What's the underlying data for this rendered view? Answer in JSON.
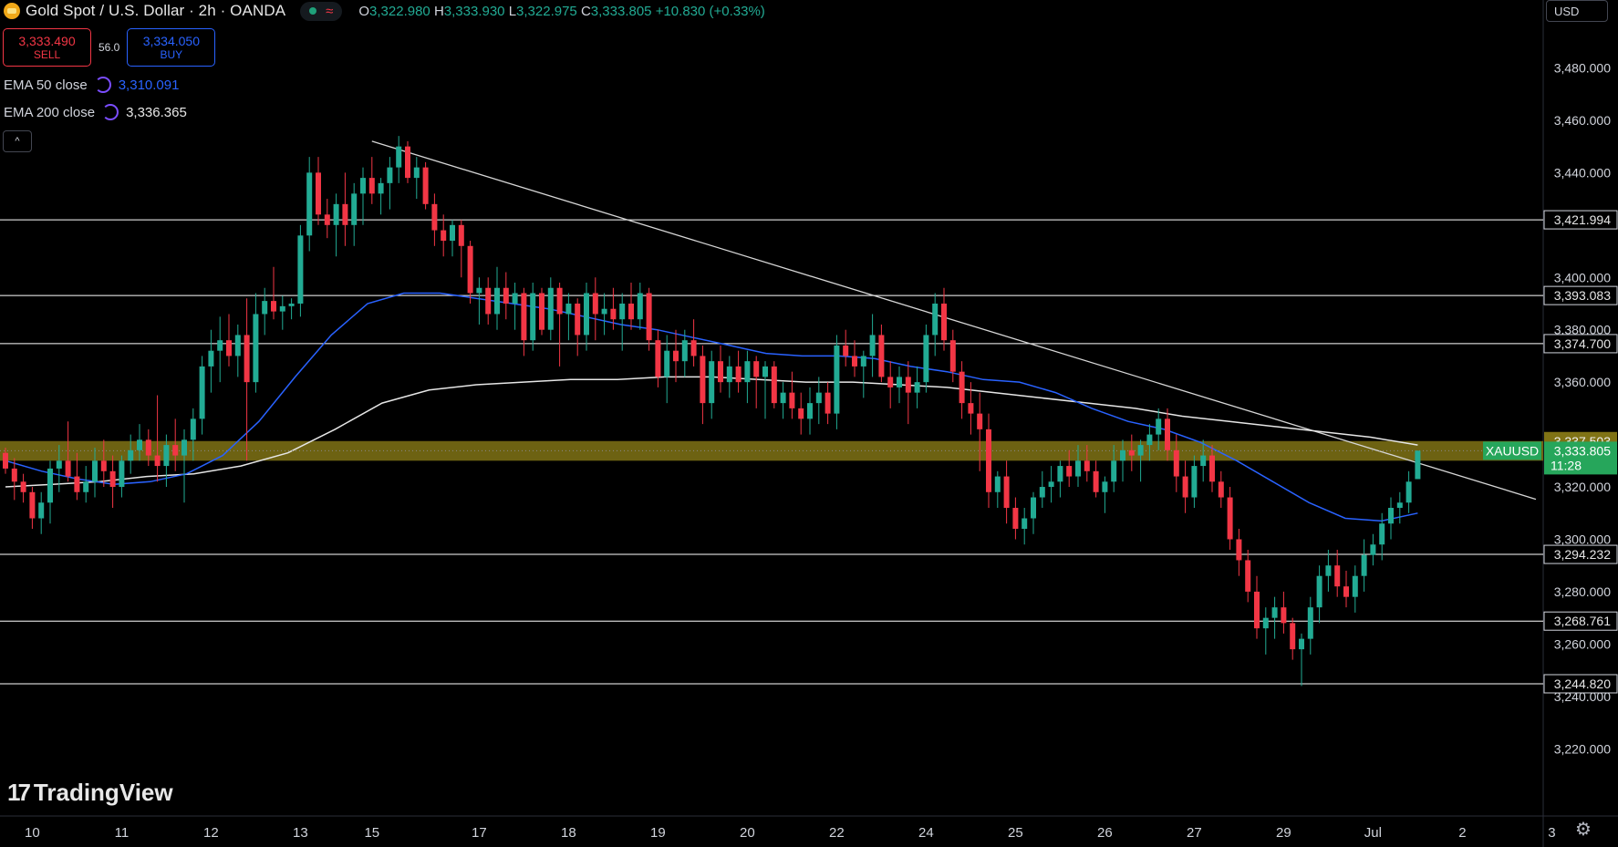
{
  "header": {
    "title": "Gold Spot / U.S. Dollar · 2h · OANDA",
    "wave_glyph": "≈",
    "ohlc": {
      "o_label": "O",
      "o": "3,322.980",
      "h_label": "H",
      "h": "3,333.930",
      "l_label": "L",
      "l": "3,322.975",
      "c_label": "C",
      "c": "3,333.805",
      "change": "+10.830 (+0.33%)"
    }
  },
  "trade": {
    "sell_price": "3,333.490",
    "sell_label": "SELL",
    "spread": "56.0",
    "buy_price": "3,334.050",
    "buy_label": "BUY"
  },
  "indicators": {
    "ema50_label": "EMA 50 close",
    "ema50_value": "3,310.091",
    "ema200_label": "EMA 200 close",
    "ema200_value": "3,336.365"
  },
  "collapse_glyph": "^",
  "branding": {
    "name": "TradingView",
    "mark": "17"
  },
  "axis": {
    "currency": "USD",
    "settings_glyph": "⚙"
  },
  "colors": {
    "bull": "#22ab94",
    "bear": "#f23645",
    "ema50": "#2962ff",
    "ema200": "#e6e6e6",
    "zone": "#807315",
    "hline": "#ffffff",
    "price_label": "#26a65b"
  },
  "chart_data": {
    "type": "candlestick",
    "symbol": "XAUUSD",
    "last_price": "3,333.805",
    "countdown": "11:28",
    "ylim": [
      3210,
      3492
    ],
    "y_ticks": [
      "3,480.000",
      "3,460.000",
      "3,440.000",
      "3,400.000",
      "3,380.000",
      "3,360.000",
      "3,320.000",
      "3,300.000",
      "3,280.000",
      "3,260.000",
      "3,240.000",
      "3,220.000"
    ],
    "y_tick_values": [
      3480,
      3460,
      3440,
      3400,
      3380,
      3360,
      3320,
      3300,
      3280,
      3260,
      3240,
      3220
    ],
    "x_ticks": [
      "10",
      "11",
      "12",
      "13",
      "15",
      "17",
      "18",
      "19",
      "20",
      "22",
      "24",
      "25",
      "26",
      "27",
      "29",
      "Jul",
      "2",
      "3"
    ],
    "x_tick_index": [
      3,
      13,
      23,
      33,
      41,
      53,
      63,
      73,
      83,
      93,
      103,
      113,
      123,
      133,
      143,
      153,
      163,
      173
    ],
    "levels": [
      {
        "label": "3,421.994",
        "value": 3421.994
      },
      {
        "label": "3,393.083",
        "value": 3393.083
      },
      {
        "label": "3,374.700",
        "value": 3374.7
      },
      {
        "label": "3,294.232",
        "value": 3294.232
      },
      {
        "label": "3,268.761",
        "value": 3268.761
      },
      {
        "label": "3,244.820",
        "value": 3244.82
      }
    ],
    "zone": {
      "label": "3,337.503",
      "high": 3337.503,
      "low": 3330.0
    },
    "trendline": {
      "start_index": 41,
      "start_value": 3452,
      "end_index": 171.5,
      "end_value": 3315
    },
    "candles": [
      [
        3333,
        3335,
        3325,
        3327
      ],
      [
        3327,
        3331,
        3315,
        3322
      ],
      [
        3322,
        3325,
        3314,
        3318
      ],
      [
        3318,
        3320,
        3304,
        3308
      ],
      [
        3308,
        3318,
        3302,
        3314
      ],
      [
        3314,
        3330,
        3306,
        3327
      ],
      [
        3327,
        3336,
        3318,
        3330
      ],
      [
        3330,
        3345,
        3322,
        3324
      ],
      [
        3324,
        3333,
        3315,
        3318
      ],
      [
        3318,
        3328,
        3314,
        3322
      ],
      [
        3322,
        3335,
        3316,
        3330
      ],
      [
        3330,
        3338,
        3320,
        3326
      ],
      [
        3326,
        3332,
        3312,
        3320
      ],
      [
        3320,
        3332,
        3316,
        3330
      ],
      [
        3330,
        3340,
        3325,
        3334
      ],
      [
        3334,
        3344,
        3330,
        3338
      ],
      [
        3338,
        3342,
        3328,
        3332
      ],
      [
        3332,
        3355,
        3322,
        3328
      ],
      [
        3328,
        3340,
        3320,
        3336
      ],
      [
        3336,
        3346,
        3326,
        3332
      ],
      [
        3332,
        3342,
        3314,
        3338
      ],
      [
        3338,
        3350,
        3330,
        3346
      ],
      [
        3346,
        3370,
        3340,
        3366
      ],
      [
        3366,
        3380,
        3356,
        3372
      ],
      [
        3372,
        3385,
        3360,
        3376
      ],
      [
        3376,
        3386,
        3366,
        3370
      ],
      [
        3370,
        3382,
        3362,
        3378
      ],
      [
        3378,
        3392,
        3330,
        3360
      ],
      [
        3360,
        3394,
        3356,
        3386
      ],
      [
        3386,
        3396,
        3378,
        3391
      ],
      [
        3391,
        3404,
        3384,
        3387
      ],
      [
        3387,
        3393,
        3380,
        3389
      ],
      [
        3389,
        3392,
        3384,
        3390
      ],
      [
        3390,
        3420,
        3385,
        3416
      ],
      [
        3416,
        3446,
        3410,
        3440
      ],
      [
        3440,
        3446,
        3420,
        3424
      ],
      [
        3424,
        3430,
        3415,
        3420
      ],
      [
        3420,
        3432,
        3408,
        3428
      ],
      [
        3428,
        3440,
        3412,
        3420
      ],
      [
        3420,
        3436,
        3412,
        3432
      ],
      [
        3432,
        3442,
        3420,
        3438
      ],
      [
        3438,
        3446,
        3428,
        3432
      ],
      [
        3432,
        3438,
        3424,
        3436
      ],
      [
        3436,
        3446,
        3426,
        3442
      ],
      [
        3442,
        3454,
        3436,
        3450
      ],
      [
        3450,
        3452,
        3436,
        3438
      ],
      [
        3438,
        3446,
        3430,
        3442
      ],
      [
        3442,
        3444,
        3426,
        3428
      ],
      [
        3428,
        3432,
        3412,
        3418
      ],
      [
        3418,
        3424,
        3408,
        3414
      ],
      [
        3414,
        3422,
        3408,
        3420
      ],
      [
        3420,
        3422,
        3400,
        3412
      ],
      [
        3412,
        3414,
        3390,
        3394
      ],
      [
        3394,
        3400,
        3382,
        3396
      ],
      [
        3396,
        3400,
        3382,
        3386
      ],
      [
        3386,
        3404,
        3380,
        3396
      ],
      [
        3396,
        3402,
        3384,
        3390
      ],
      [
        3390,
        3398,
        3380,
        3394
      ],
      [
        3394,
        3396,
        3370,
        3376
      ],
      [
        3376,
        3398,
        3372,
        3394
      ],
      [
        3394,
        3396,
        3378,
        3380
      ],
      [
        3380,
        3400,
        3376,
        3396
      ],
      [
        3396,
        3398,
        3366,
        3386
      ],
      [
        3386,
        3394,
        3376,
        3390
      ],
      [
        3390,
        3392,
        3370,
        3378
      ],
      [
        3378,
        3398,
        3372,
        3394
      ],
      [
        3394,
        3400,
        3376,
        3386
      ],
      [
        3386,
        3394,
        3378,
        3388
      ],
      [
        3388,
        3396,
        3380,
        3384
      ],
      [
        3384,
        3394,
        3372,
        3390
      ],
      [
        3390,
        3398,
        3380,
        3384
      ],
      [
        3384,
        3398,
        3380,
        3394
      ],
      [
        3394,
        3396,
        3372,
        3376
      ],
      [
        3376,
        3380,
        3358,
        3362
      ],
      [
        3362,
        3378,
        3352,
        3372
      ],
      [
        3372,
        3380,
        3360,
        3368
      ],
      [
        3368,
        3380,
        3362,
        3376
      ],
      [
        3376,
        3384,
        3366,
        3370
      ],
      [
        3370,
        3374,
        3344,
        3352
      ],
      [
        3352,
        3372,
        3346,
        3368
      ],
      [
        3368,
        3374,
        3356,
        3360
      ],
      [
        3360,
        3370,
        3354,
        3366
      ],
      [
        3366,
        3372,
        3356,
        3360
      ],
      [
        3360,
        3372,
        3352,
        3368
      ],
      [
        3368,
        3370,
        3350,
        3362
      ],
      [
        3362,
        3368,
        3346,
        3366
      ],
      [
        3366,
        3368,
        3350,
        3352
      ],
      [
        3352,
        3360,
        3346,
        3356
      ],
      [
        3356,
        3364,
        3346,
        3350
      ],
      [
        3350,
        3356,
        3340,
        3346
      ],
      [
        3346,
        3358,
        3340,
        3352
      ],
      [
        3352,
        3362,
        3344,
        3356
      ],
      [
        3356,
        3360,
        3344,
        3348
      ],
      [
        3348,
        3378,
        3342,
        3374
      ],
      [
        3374,
        3380,
        3366,
        3370
      ],
      [
        3370,
        3376,
        3362,
        3366
      ],
      [
        3366,
        3372,
        3354,
        3370
      ],
      [
        3370,
        3386,
        3362,
        3378
      ],
      [
        3378,
        3382,
        3360,
        3362
      ],
      [
        3362,
        3368,
        3350,
        3358
      ],
      [
        3358,
        3366,
        3352,
        3362
      ],
      [
        3362,
        3368,
        3344,
        3356
      ],
      [
        3356,
        3366,
        3350,
        3360
      ],
      [
        3360,
        3382,
        3356,
        3378
      ],
      [
        3378,
        3394,
        3370,
        3390
      ],
      [
        3390,
        3396,
        3372,
        3376
      ],
      [
        3376,
        3380,
        3360,
        3364
      ],
      [
        3364,
        3368,
        3346,
        3352
      ],
      [
        3352,
        3360,
        3340,
        3348
      ],
      [
        3348,
        3356,
        3326,
        3342
      ],
      [
        3342,
        3348,
        3312,
        3318
      ],
      [
        3318,
        3326,
        3312,
        3324
      ],
      [
        3324,
        3330,
        3306,
        3312
      ],
      [
        3312,
        3316,
        3300,
        3304
      ],
      [
        3304,
        3312,
        3298,
        3308
      ],
      [
        3308,
        3318,
        3302,
        3316
      ],
      [
        3316,
        3326,
        3312,
        3320
      ],
      [
        3320,
        3328,
        3314,
        3322
      ],
      [
        3322,
        3330,
        3316,
        3328
      ],
      [
        3328,
        3334,
        3320,
        3324
      ],
      [
        3324,
        3336,
        3320,
        3330
      ],
      [
        3330,
        3336,
        3322,
        3326
      ],
      [
        3326,
        3330,
        3316,
        3318
      ],
      [
        3318,
        3324,
        3310,
        3322
      ],
      [
        3322,
        3336,
        3318,
        3330
      ],
      [
        3330,
        3338,
        3322,
        3334
      ],
      [
        3334,
        3340,
        3326,
        3332
      ],
      [
        3332,
        3338,
        3322,
        3336
      ],
      [
        3336,
        3344,
        3330,
        3340
      ],
      [
        3340,
        3350,
        3334,
        3346
      ],
      [
        3346,
        3350,
        3330,
        3334
      ],
      [
        3334,
        3340,
        3318,
        3324
      ],
      [
        3324,
        3330,
        3310,
        3316
      ],
      [
        3316,
        3332,
        3312,
        3328
      ],
      [
        3328,
        3338,
        3322,
        3332
      ],
      [
        3332,
        3336,
        3318,
        3322
      ],
      [
        3322,
        3326,
        3312,
        3316
      ],
      [
        3316,
        3320,
        3296,
        3300
      ],
      [
        3300,
        3304,
        3286,
        3292
      ],
      [
        3292,
        3296,
        3276,
        3280
      ],
      [
        3280,
        3286,
        3262,
        3266
      ],
      [
        3266,
        3274,
        3256,
        3270
      ],
      [
        3270,
        3278,
        3262,
        3274
      ],
      [
        3274,
        3280,
        3264,
        3268
      ],
      [
        3268,
        3270,
        3254,
        3258
      ],
      [
        3258,
        3264,
        3244,
        3262
      ],
      [
        3262,
        3278,
        3256,
        3274
      ],
      [
        3274,
        3290,
        3268,
        3286
      ],
      [
        3286,
        3296,
        3280,
        3290
      ],
      [
        3290,
        3296,
        3278,
        3282
      ],
      [
        3282,
        3288,
        3274,
        3278
      ],
      [
        3278,
        3290,
        3272,
        3286
      ],
      [
        3286,
        3300,
        3280,
        3294
      ],
      [
        3294,
        3302,
        3290,
        3298
      ],
      [
        3298,
        3310,
        3292,
        3306
      ],
      [
        3306,
        3316,
        3300,
        3312
      ],
      [
        3312,
        3318,
        3306,
        3314
      ],
      [
        3314,
        3326,
        3310,
        3322
      ],
      [
        3322.98,
        3333.93,
        3322.975,
        3333.805
      ]
    ],
    "ema50": [
      3330,
      3326,
      3323,
      3321,
      3322,
      3325,
      3332,
      3345,
      3362,
      3378,
      3390,
      3394,
      3394,
      3392,
      3390,
      3388,
      3385,
      3382,
      3380,
      3377,
      3374,
      3371,
      3370,
      3370,
      3369,
      3366,
      3364,
      3361,
      3360,
      3356,
      3350,
      3345,
      3342,
      3337,
      3330,
      3322,
      3314,
      3308,
      3307,
      3310
    ],
    "ema200": [
      3320,
      3321,
      3322,
      3324,
      3325,
      3328,
      3333,
      3342,
      3352,
      3357,
      3359,
      3360,
      3361,
      3361,
      3362,
      3362,
      3361,
      3360,
      3360,
      3359,
      3358,
      3356,
      3354,
      3352,
      3350,
      3347,
      3345,
      3343,
      3341,
      3339,
      3336
    ]
  }
}
